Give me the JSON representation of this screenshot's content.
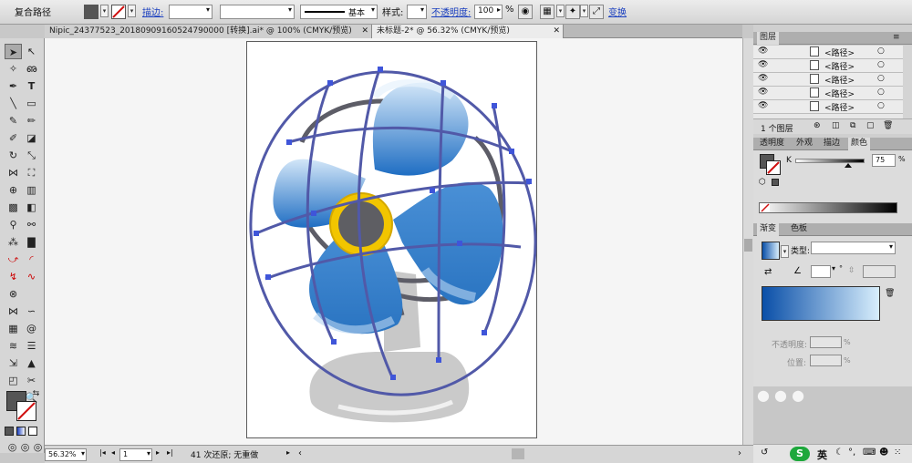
{
  "control_bar": {
    "title": "复合路径",
    "stroke_label": "描边:",
    "stroke_weight": "",
    "brush_preset": "基本",
    "style_label": "样式:",
    "opacity_label": "不透明度:",
    "opacity_value": "100",
    "opacity_unit": "%",
    "transform_label": "变换",
    "fill_color": "#555555",
    "stroke_none_color": "#d01010"
  },
  "document_tabs": [
    {
      "label": "Nipic_24377523_20180909160524790000 [转换].ai* @ 100% (CMYK/预览)",
      "active": false
    },
    {
      "label": "未标题-2* @ 56.32% (CMYK/预览)",
      "active": true
    }
  ],
  "status_bar": {
    "zoom": "56.32%",
    "page": "1",
    "history": "41 次还原; 无重做"
  },
  "layers_panel": {
    "title": "图层",
    "items": [
      {
        "label": "<路径>"
      },
      {
        "label": "<路径>"
      },
      {
        "label": "<路径>"
      },
      {
        "label": "<路径>"
      },
      {
        "label": "<路径>"
      }
    ],
    "footer": "1 个图层"
  },
  "color_panel": {
    "tabs": [
      "透明度",
      "外观",
      "描边",
      "颜色"
    ],
    "active_tab": "颜色",
    "channel": "K",
    "value": "75",
    "unit": "%",
    "slider_fraction": 0.75
  },
  "gradient_panel": {
    "tabs": [
      "渐变",
      "色板"
    ],
    "type_label": "类型:",
    "opacity_label": "不透明度:",
    "opacity_unit": "%",
    "location_label": "位置:",
    "location_unit": "%",
    "gradient_start": "#0a4fa8",
    "gradient_end": "#d8eefc"
  },
  "taskbar": {
    "ime_label": "英"
  }
}
